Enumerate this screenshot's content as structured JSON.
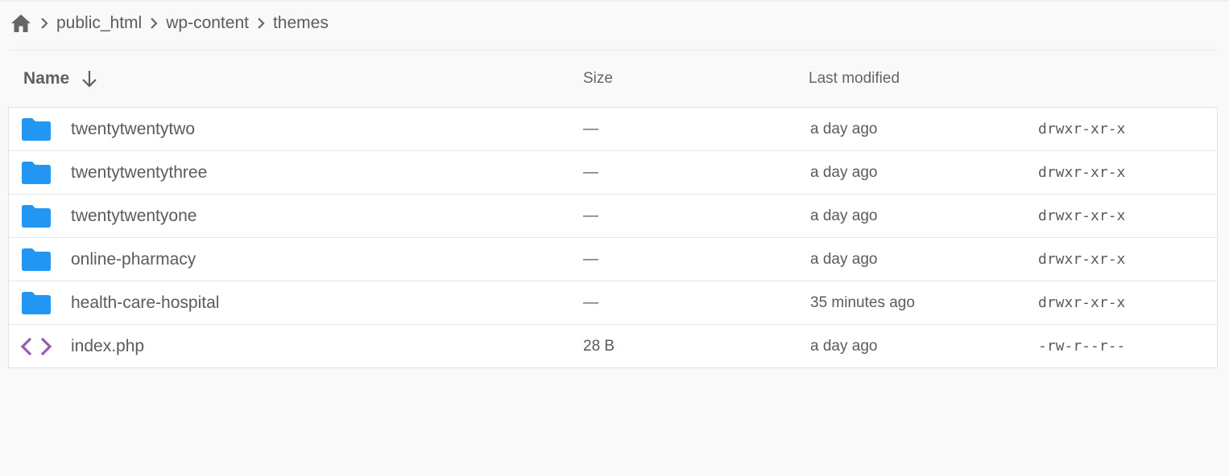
{
  "breadcrumb": {
    "home_icon": "home-icon",
    "separator_icon": "chevron-right-icon",
    "items": [
      "public_html",
      "wp-content",
      "themes"
    ]
  },
  "table": {
    "columns": {
      "name": "Name",
      "size": "Size",
      "modified": "Last modified"
    },
    "sort": {
      "column": "Name",
      "direction": "descending",
      "icon": "arrow-down-icon"
    },
    "rows": [
      {
        "type": "folder",
        "icon": "folder-icon",
        "name": "twentytwentytwo",
        "size": "—",
        "modified": "a day ago",
        "permissions": "drwxr-xr-x"
      },
      {
        "type": "folder",
        "icon": "folder-icon",
        "name": "twentytwentythree",
        "size": "—",
        "modified": "a day ago",
        "permissions": "drwxr-xr-x"
      },
      {
        "type": "folder",
        "icon": "folder-icon",
        "name": "twentytwentyone",
        "size": "—",
        "modified": "a day ago",
        "permissions": "drwxr-xr-x"
      },
      {
        "type": "folder",
        "icon": "folder-icon",
        "name": "online-pharmacy",
        "size": "—",
        "modified": "a day ago",
        "permissions": "drwxr-xr-x"
      },
      {
        "type": "folder",
        "icon": "folder-icon",
        "name": "health-care-hospital",
        "size": "—",
        "modified": "35 minutes ago",
        "permissions": "drwxr-xr-x"
      },
      {
        "type": "file",
        "icon": "code-file-icon",
        "name": "index.php",
        "size": "28 B",
        "modified": "a day ago",
        "permissions": "-rw-r--r--"
      }
    ]
  },
  "colors": {
    "folder": "#2196f3",
    "code_file": "#9b59b6",
    "text": "#5b5b5b",
    "background": "#f9f9f9",
    "row_background": "#ffffff",
    "border": "#e3e3e3"
  }
}
